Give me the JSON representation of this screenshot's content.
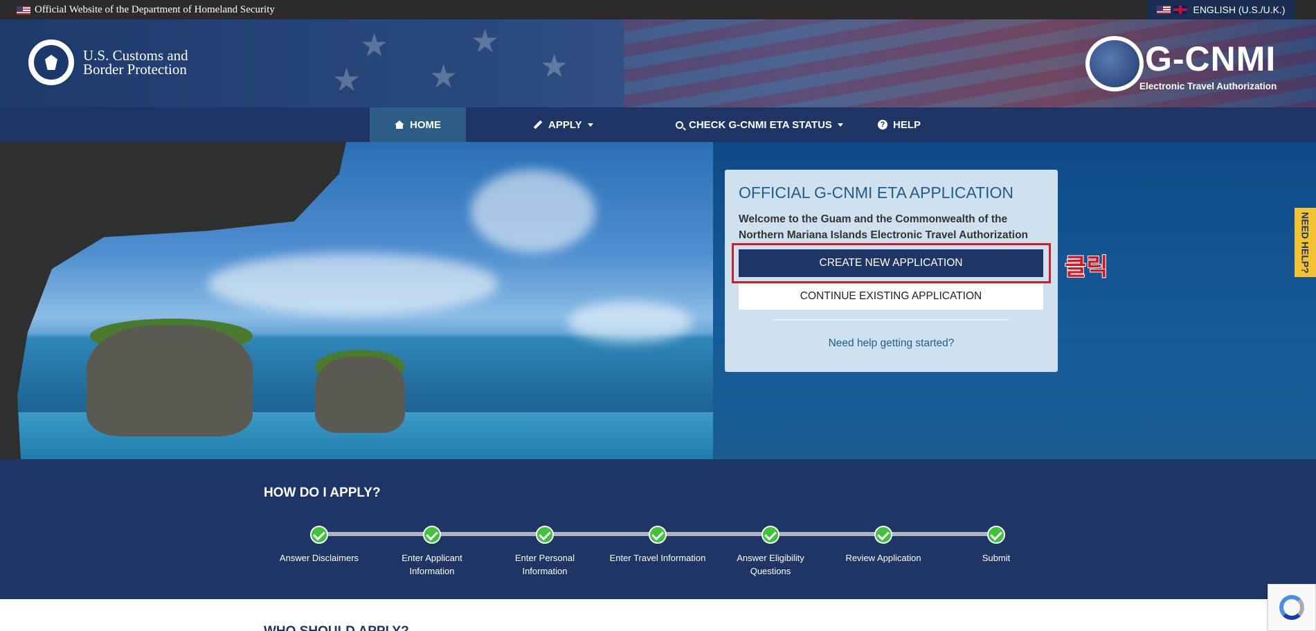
{
  "topbar": {
    "official_text": "Official Website of the Department of Homeland Security",
    "language_label": "ENGLISH (U.S./U.K.)"
  },
  "header": {
    "agency_line1": "U.S. Customs and",
    "agency_line2": "Border Protection",
    "brand_title": "G-CNMI",
    "brand_subtitle": "Electronic Travel Authorization"
  },
  "nav": {
    "items": [
      {
        "label": "HOME",
        "icon": "home-icon",
        "active": true
      },
      {
        "label": "APPLY",
        "icon": "pencil-icon",
        "dropdown": true
      },
      {
        "label": "CHECK G-CNMI ETA STATUS",
        "icon": "search-icon",
        "dropdown": true
      },
      {
        "label": "HELP",
        "icon": "question-circle-icon"
      }
    ]
  },
  "card": {
    "title": "OFFICIAL G-CNMI ETA APPLICATION",
    "welcome": "Welcome to the Guam and the Commonwealth of the Northern Mariana Islands Electronic Travel Authorization",
    "create_button": "CREATE NEW APPLICATION",
    "continue_button": "CONTINUE EXISTING APPLICATION",
    "help_link": "Need help getting started?"
  },
  "annotation": {
    "text": "클릭",
    "color": "#cc1f2a"
  },
  "side_tab": {
    "label": "NEED HELP?"
  },
  "how_to_apply": {
    "heading": "HOW DO I APPLY?",
    "steps": [
      {
        "label": "Answer Disclaimers",
        "status": "complete"
      },
      {
        "label": "Enter Applicant Information",
        "status": "complete"
      },
      {
        "label": "Enter Personal Information",
        "status": "complete"
      },
      {
        "label": "Enter Travel Information",
        "status": "complete"
      },
      {
        "label": "Answer Eligibility Questions",
        "status": "complete"
      },
      {
        "label": "Review Application",
        "status": "complete"
      },
      {
        "label": "Submit",
        "status": "complete"
      }
    ]
  },
  "who_should_apply": {
    "heading": "WHO SHOULD APPLY?"
  },
  "colors": {
    "nav_bg": "#1e3566",
    "active_nav": "#2d5d84",
    "check_green": "#3ec33a",
    "need_help_yellow": "#f2c231"
  }
}
